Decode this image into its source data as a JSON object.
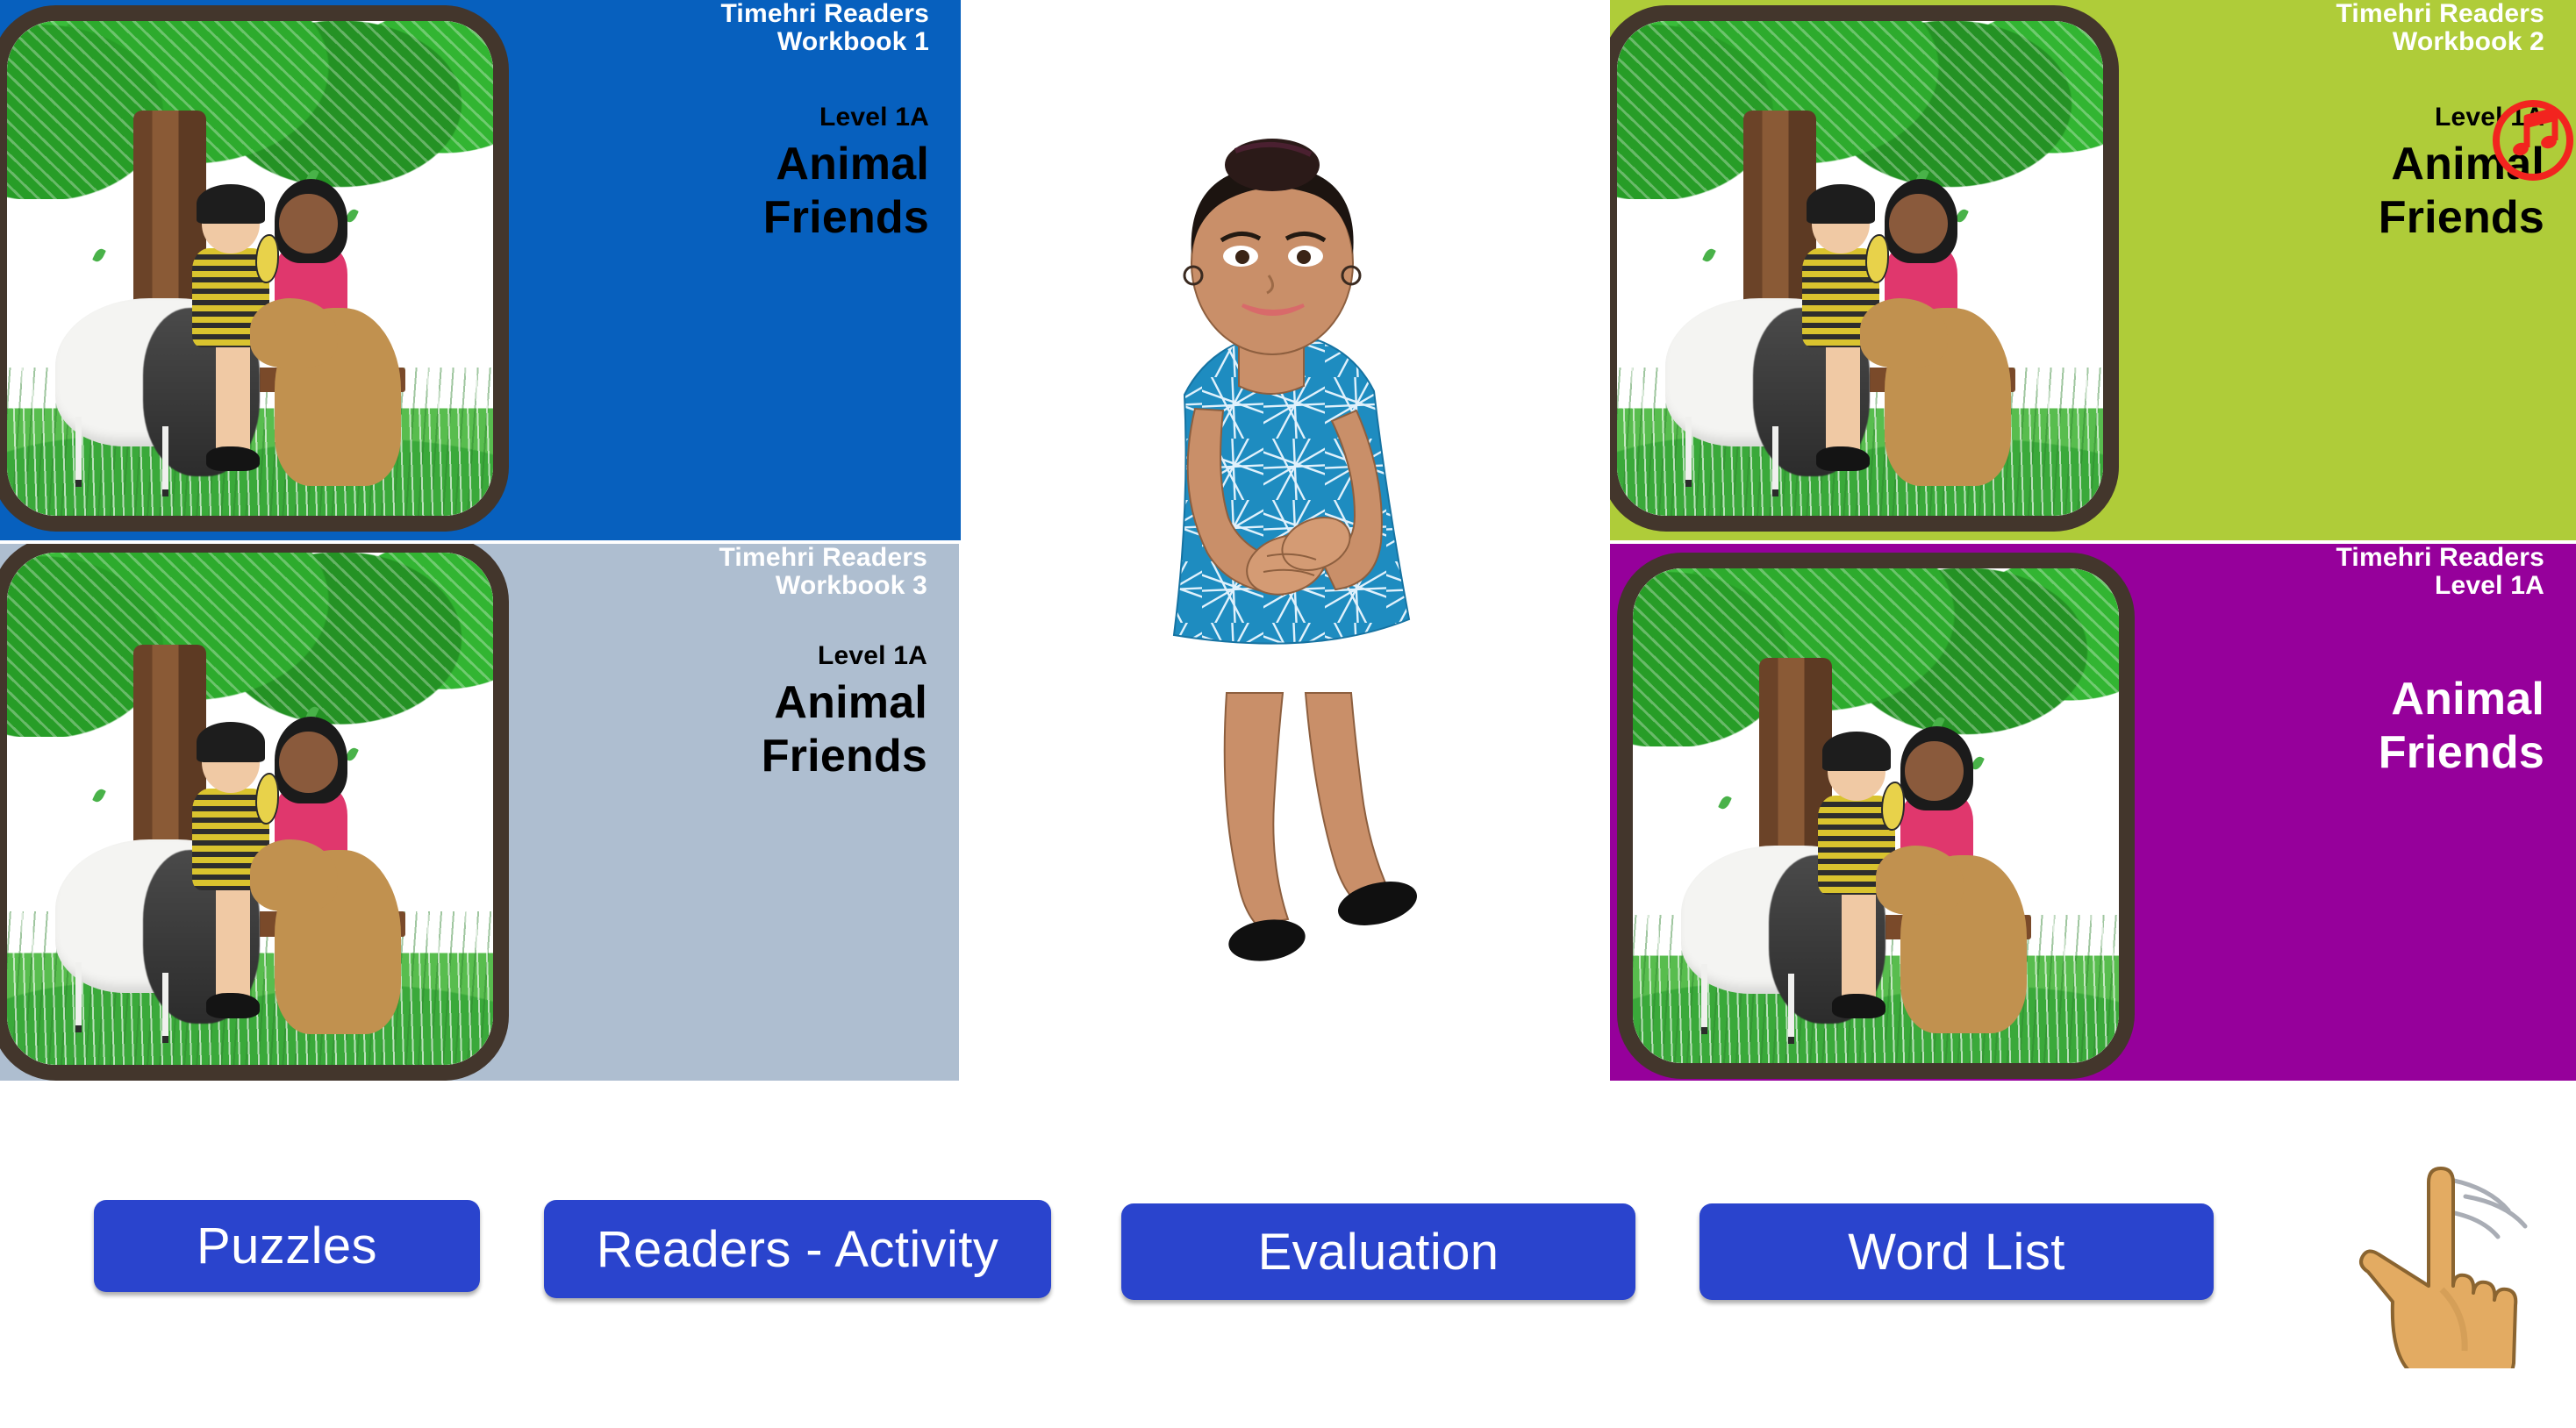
{
  "cards": [
    {
      "id": "workbook-1",
      "series": "Timehri Readers\nWorkbook 1",
      "level": "Level 1A",
      "title": "Animal\nFriends",
      "bg_color": "#0760be",
      "cover_alt": "book-cover-animal-friends"
    },
    {
      "id": "workbook-3",
      "series": "Timehri Readers\nWorkbook 3",
      "level": "Level 1A",
      "title": "Animal\nFriends",
      "bg_color": "#aebed0",
      "cover_alt": "book-cover-animal-friends"
    },
    {
      "id": "workbook-2",
      "series": "Timehri Readers\nWorkbook 2",
      "level": "Level 1A",
      "title": "Animal\nFriends",
      "bg_color": "#afcc39",
      "cover_alt": "book-cover-animal-friends"
    },
    {
      "id": "reader",
      "series": "Timehri Readers\nLevel 1A",
      "level": "",
      "title": "Animal\nFriends",
      "bg_color": "#96009b",
      "cover_alt": "book-cover-animal-friends"
    }
  ],
  "annotation": {
    "shape": "circle",
    "color": "#f2241f",
    "icon": "music-note-icon",
    "target": "Level 1A"
  },
  "avatar": {
    "name": "teacher-avatar",
    "dress_color": "#1e8cc0",
    "skin_color": "#c98f69",
    "hair_color": "#1c1410",
    "shoe_color": "#111111"
  },
  "toolbar": {
    "buttons": [
      {
        "id": "puzzles",
        "label": "Puzzles"
      },
      {
        "id": "readers",
        "label": "Readers - Activity"
      },
      {
        "id": "evaluation",
        "label": "Evaluation"
      },
      {
        "id": "wordlist",
        "label": "Word List"
      }
    ],
    "button_color": "#2a44cd",
    "button_text_color": "#ffffff"
  },
  "cursor": {
    "name": "pointing-hand-cursor",
    "skin_color": "#e3ab62",
    "motion_lines": 3
  }
}
